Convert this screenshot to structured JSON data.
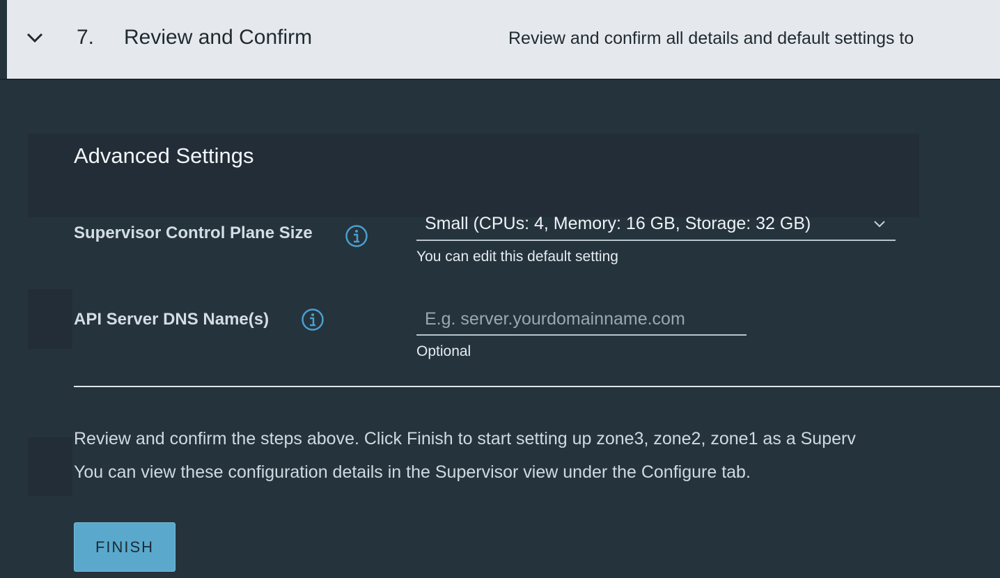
{
  "step": {
    "number": "7.",
    "title": "Review and Confirm",
    "description": "Review and confirm all details and default settings to"
  },
  "advanced": {
    "title": "Advanced Settings",
    "control_plane_size": {
      "label": "Supervisor Control Plane Size",
      "value": "Small (CPUs: 4, Memory: 16 GB, Storage: 32 GB)",
      "helper": "You can edit this default setting"
    },
    "api_dns": {
      "label": "API Server DNS Name(s)",
      "placeholder": "E.g. server.yourdomainname.com",
      "helper": "Optional"
    }
  },
  "confirm_text": {
    "line1": "Review and confirm the steps above. Click Finish to start setting up zone3, zone2, zone1 as a Superv",
    "line2": "You can view these configuration details in the Supervisor view under the Configure tab."
  },
  "finish_label": "FINISH",
  "colors": {
    "header_bg": "#e5e9ee",
    "body_bg": "#25333d",
    "accent_blue": "#5aa9cd",
    "info_icon": "#4a9fcf"
  }
}
